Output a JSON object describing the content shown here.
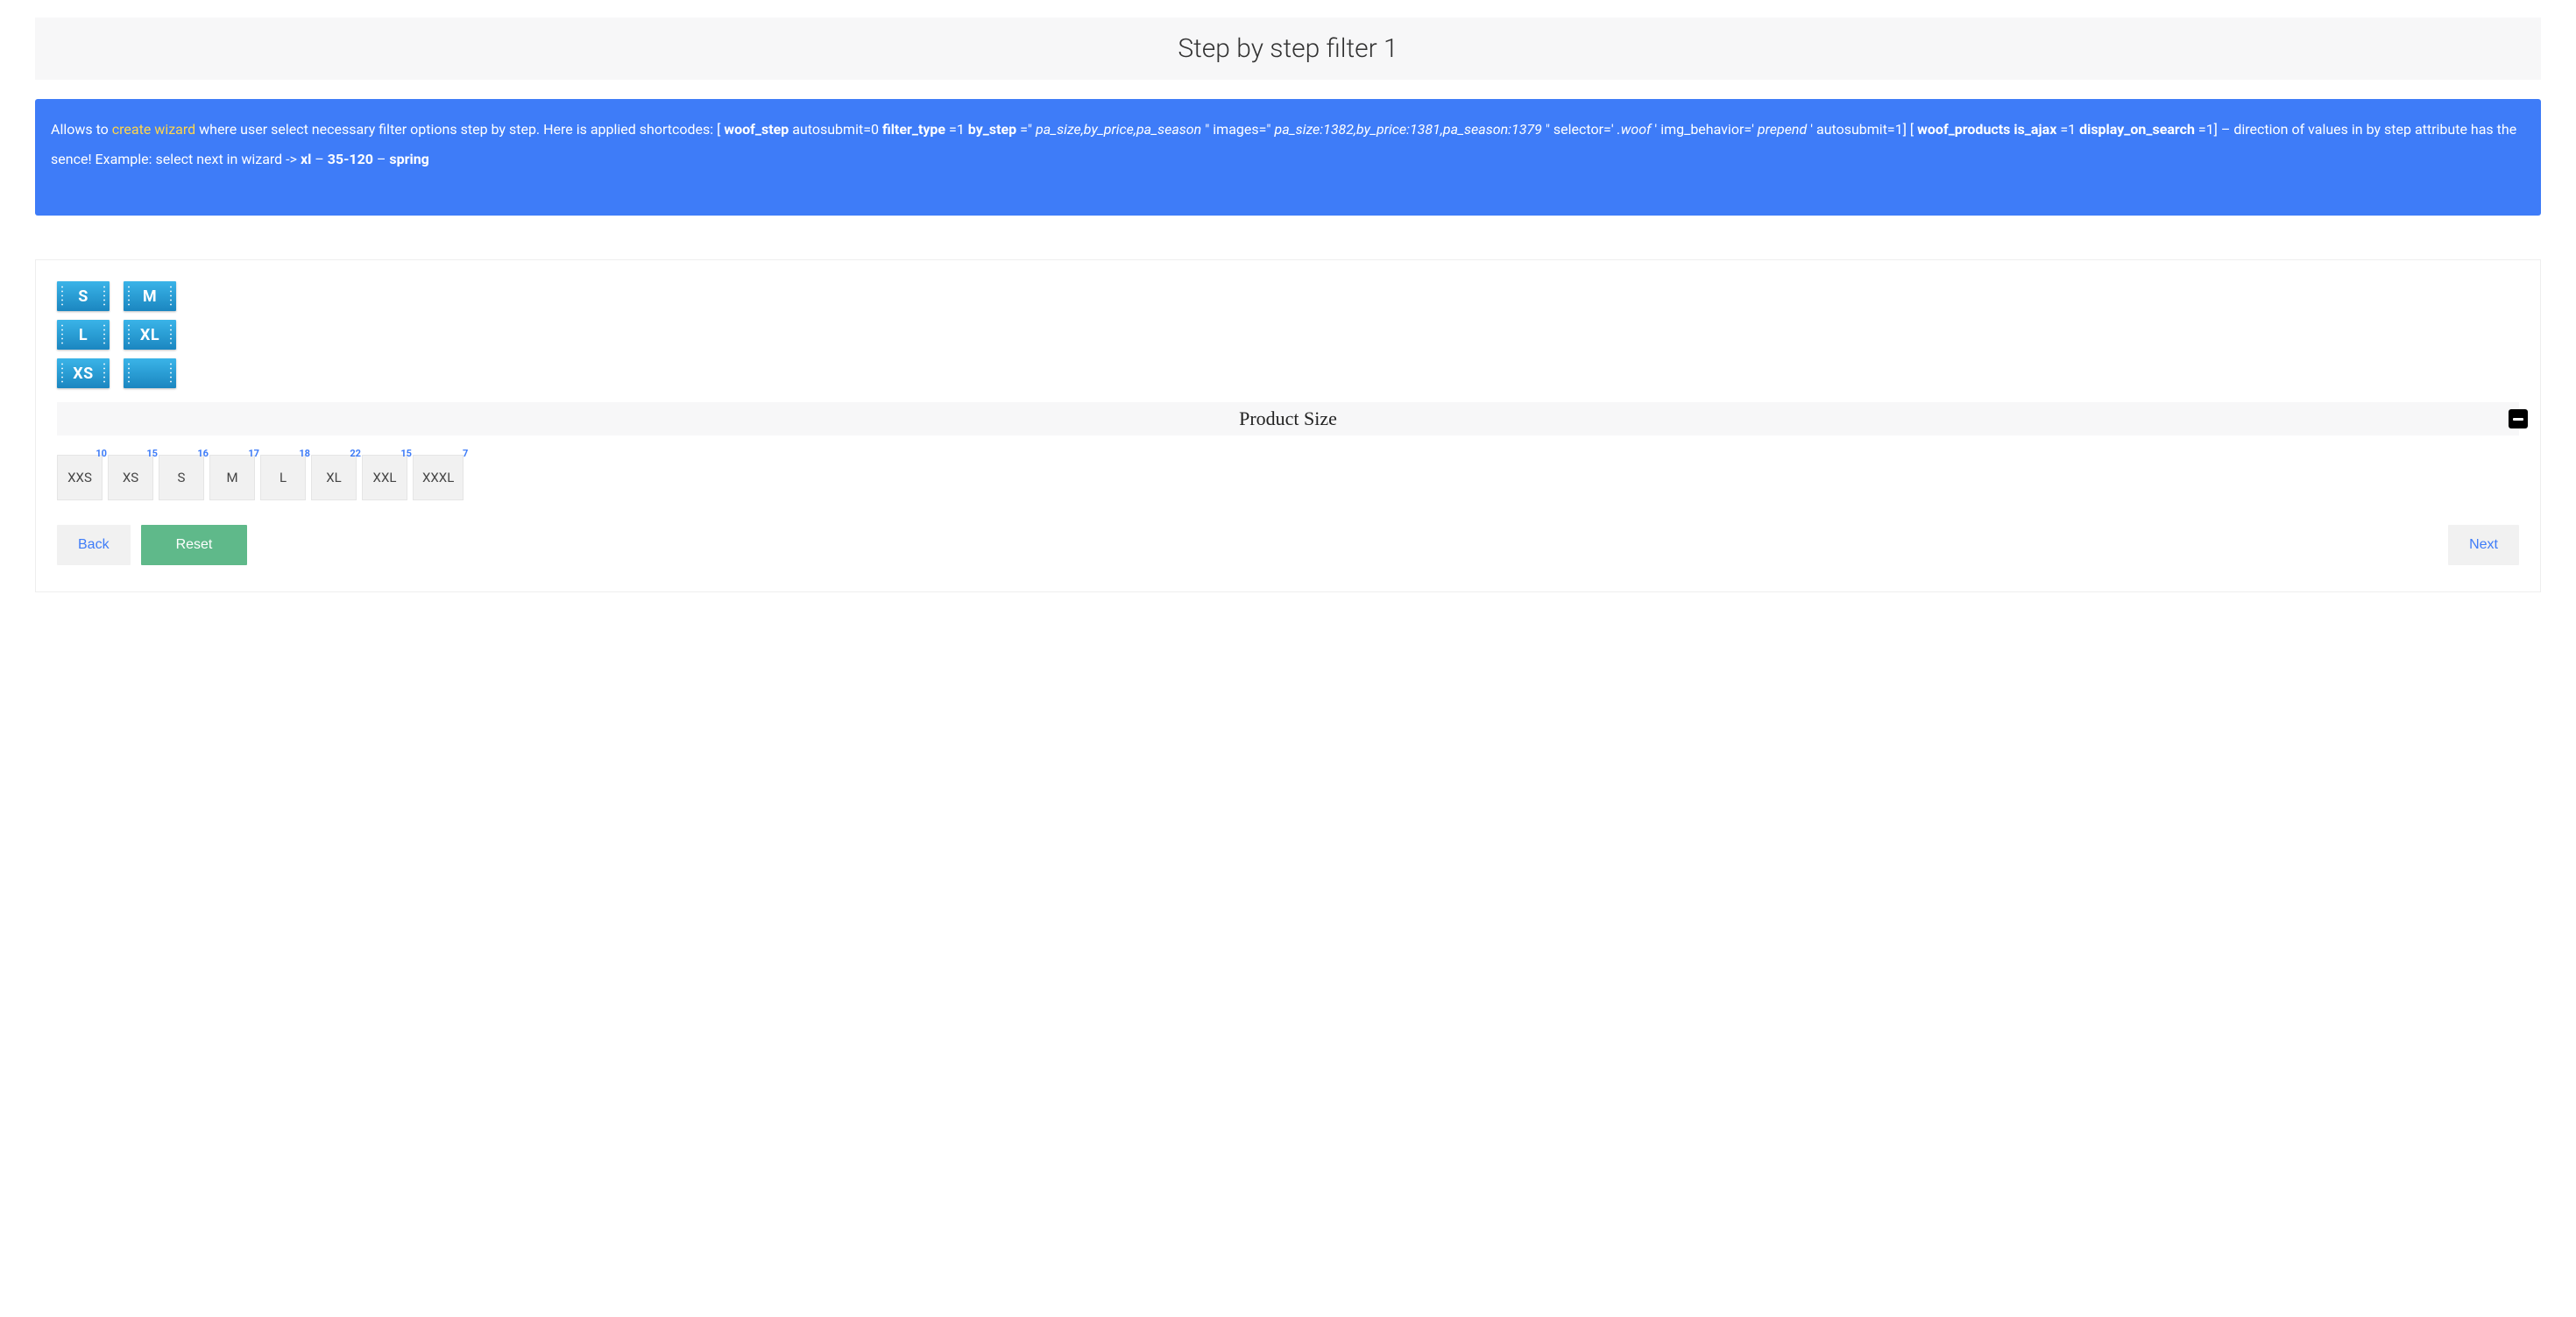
{
  "page": {
    "title": "Step by step filter 1"
  },
  "info": {
    "lead": "Allows to ",
    "link_text": "create wizard",
    "after_link": " where user select necessary filter options step by step. Here is applied shortcodes: [",
    "sc1": "woof_step",
    "sc1_after": " autosubmit=0 ",
    "filter_type_label": "filter_type",
    "filter_type_after": "=1 ",
    "by_step_label": "by_step",
    "by_step_eq": "=\"",
    "by_step_val": "pa_size,by_price,pa_season",
    "by_step_close": "\" images=\"",
    "images_val": "pa_size:1382,by_price:1381,pa_season:1379",
    "images_close": "\" selector='",
    "selector_val": ".woof",
    "selector_close": "' img_behavior='",
    "img_behavior_val": "prepend",
    "img_behavior_close": "' autosubmit=1]  [",
    "sc2_a": "woof_products is_ajax",
    "sc2_b": "=1 ",
    "display_on_search_label": "display_on_search",
    "display_on_search_after": "=1] – direction of values in by step attribute has the sence!",
    "example_lead": "Example: select next in wizard -> ",
    "ex_xl": "xl",
    "ex_sep1": " – ",
    "ex_price": "35-120",
    "ex_sep2": " – ",
    "ex_spring": "spring"
  },
  "icons": [
    "S",
    "M",
    "L",
    "XL",
    "XS",
    ""
  ],
  "section": {
    "title": "Product Size"
  },
  "sizes": [
    {
      "label": "XXS",
      "count": 10
    },
    {
      "label": "XS",
      "count": 15
    },
    {
      "label": "S",
      "count": 16
    },
    {
      "label": "M",
      "count": 17
    },
    {
      "label": "L",
      "count": 18
    },
    {
      "label": "XL",
      "count": 22
    },
    {
      "label": "XXL",
      "count": 15
    },
    {
      "label": "XXXL",
      "count": 7
    }
  ],
  "buttons": {
    "back": "Back",
    "reset": "Reset",
    "next": "Next"
  }
}
